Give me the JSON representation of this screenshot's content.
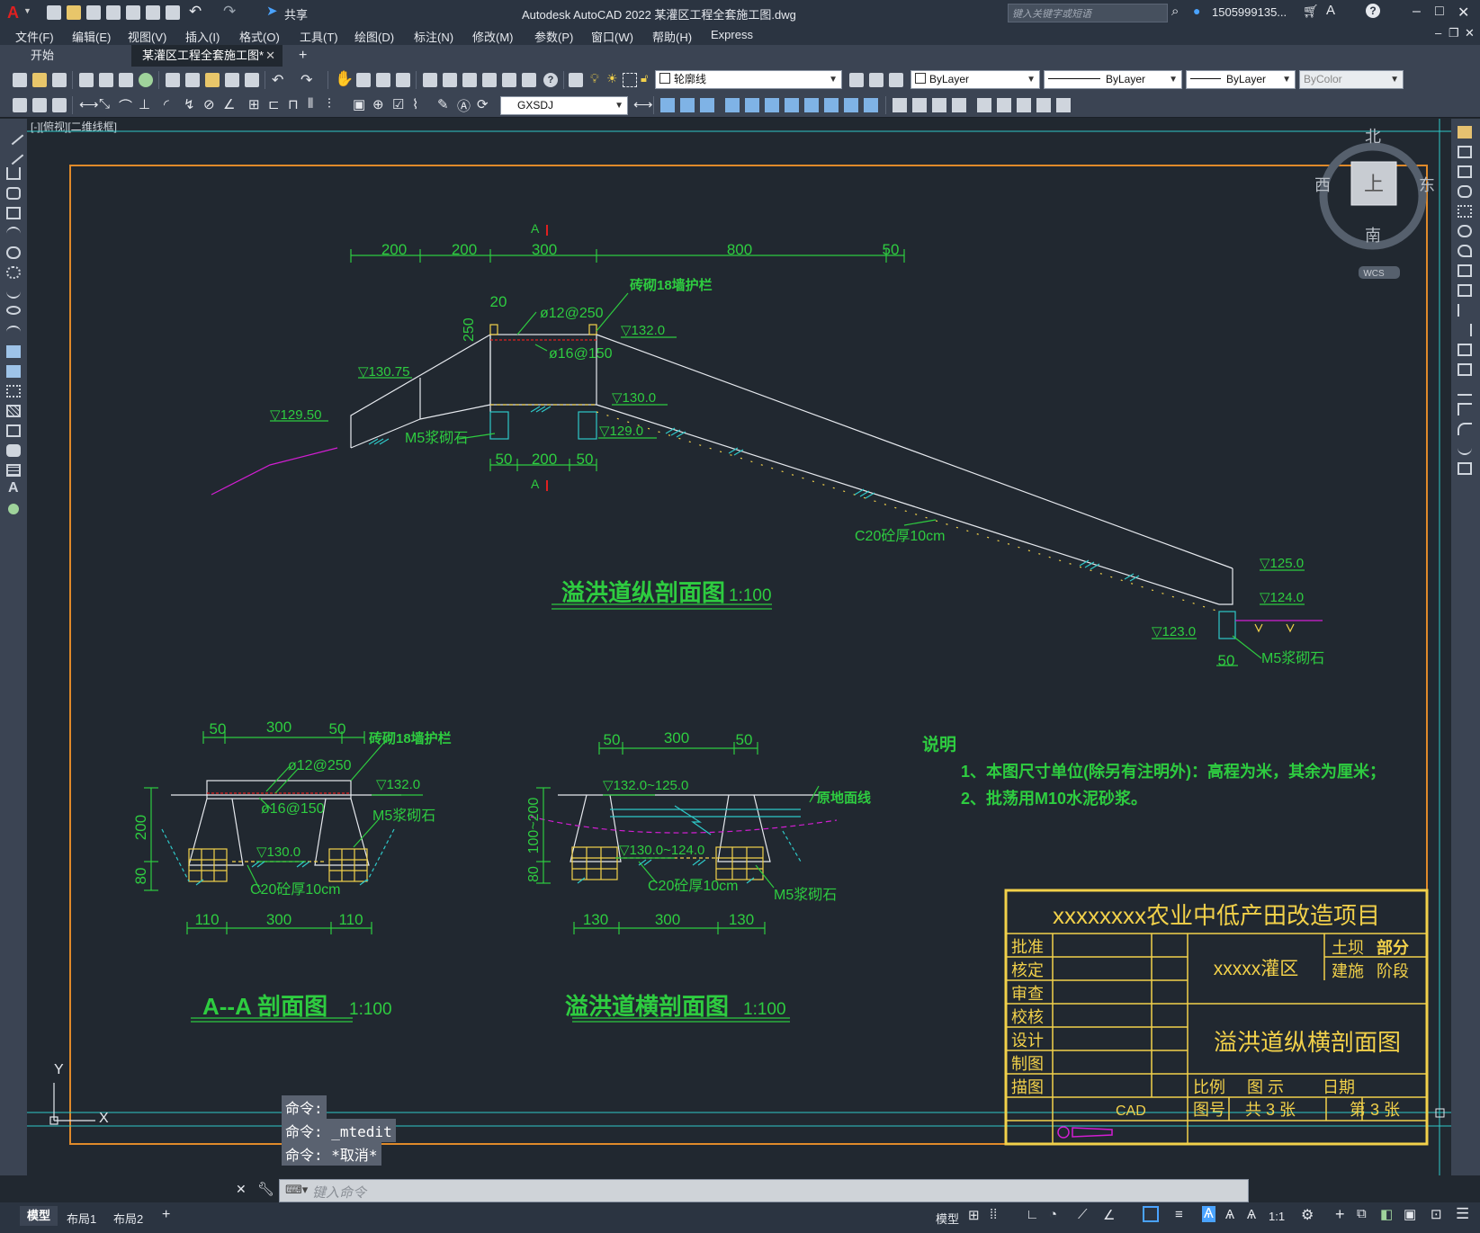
{
  "app": {
    "title": "Autodesk AutoCAD 2022 某灌区工程全套施工图.dwg",
    "share_label": "共享",
    "search_placeholder": "键入关键字或短语",
    "user": "1505999135..."
  },
  "menu": [
    "文件(F)",
    "编辑(E)",
    "视图(V)",
    "插入(I)",
    "格式(O)",
    "工具(T)",
    "绘图(D)",
    "标注(N)",
    "修改(M)",
    "参数(P)",
    "窗口(W)",
    "帮助(H)",
    "Express"
  ],
  "tabs": {
    "start": "开始",
    "active": "某灌区工程全套施工图*",
    "add": "+"
  },
  "toolbar": {
    "layer": "轮廓线",
    "color": "ByLayer",
    "linetype": "ByLayer",
    "lineweight": "ByLayer",
    "plotstyle": "ByColor",
    "dimstyle": "GXSDJ"
  },
  "viewport_label": "[-][俯视][二维线框]",
  "viewcube": {
    "north": "北",
    "south": "南",
    "east": "东",
    "west": "西",
    "face": "上",
    "wcs": "WCS"
  },
  "drawing": {
    "long_section": {
      "title": "溢洪道纵剖面图",
      "scale": "1:100",
      "section_mark": "A",
      "dims": [
        "200",
        "200",
        "300",
        "800",
        "50"
      ],
      "dim_20": "20",
      "dim_250": "250",
      "wall": "砖砌18墙护栏",
      "rebar1": "ø12@250",
      "rebar2": "ø16@150",
      "el_132": "▽132.0",
      "el_13075": "▽130.75",
      "el_12950": "▽129.50",
      "el_1300": "▽130.0",
      "el_1290": "▽129.0",
      "stone": "M5浆砌石",
      "bottom_dims": [
        "50",
        "200",
        "50"
      ],
      "concrete": "C20砼厚10cm",
      "el_1250": "▽125.0",
      "el_1240": "▽124.0",
      "el_1230": "▽123.0",
      "dim_end": "50",
      "stone_end": "M5浆砌石"
    },
    "section_aa": {
      "title": "A--A 剖面图",
      "scale": "1:100",
      "top_dims": [
        "50",
        "300",
        "50"
      ],
      "wall": "砖砌18墙护栏",
      "rebar1": "ø12@250",
      "rebar2": "ø16@150",
      "el_132": "▽132.0",
      "el_130": "▽130.0",
      "stone": "M5浆砌石",
      "concrete": "C20砼厚10cm",
      "left_dims": [
        "200",
        "80"
      ],
      "bottom_dims": [
        "110",
        "300",
        "110"
      ]
    },
    "cross_section": {
      "title": "溢洪道横剖面图",
      "scale": "1:100",
      "top_dims": [
        "50",
        "300",
        "50"
      ],
      "el_top": "▽132.0~125.0",
      "el_bot": "▽130.0~124.0",
      "ground": "原地面线",
      "stone": "M5浆砌石",
      "concrete": "C20砼厚10cm",
      "left_dims": [
        "100~200",
        "80"
      ],
      "bottom_dims": [
        "130",
        "300",
        "130"
      ]
    },
    "notes": {
      "title": "说明",
      "line1": "1、本图尺寸单位(除另有注明外)：高程为米，其余为厘米；",
      "line2": "2、批荡用M10水泥砂浆。"
    },
    "titleblock": {
      "project": "xxxxxxxx农业中低产田改造项目",
      "district": "xxxxx灌区",
      "dept_a": "土坝",
      "dept_b": "部分",
      "phase_a": "建施",
      "phase_b": "阶段",
      "drawing_name": "溢洪道纵横剖面图",
      "rows": [
        "批准",
        "核定",
        "审查",
        "校核",
        "设计",
        "制图",
        "描图"
      ],
      "scale_label": "比例",
      "scale_value": "图  示",
      "date_label": "日期",
      "no_label": "图号",
      "total": "共 3 张",
      "sheet": "第 3 张",
      "cad_label": "CAD"
    }
  },
  "ucs": {
    "x": "X",
    "y": "Y"
  },
  "command_history": [
    "命令:",
    "命令: _mtedit",
    "命令: *取消*"
  ],
  "command_placeholder": "键入命令",
  "layout_tabs": [
    "模型",
    "布局1",
    "布局2",
    "+"
  ],
  "status": {
    "model": "模型",
    "scale": "1:1"
  }
}
